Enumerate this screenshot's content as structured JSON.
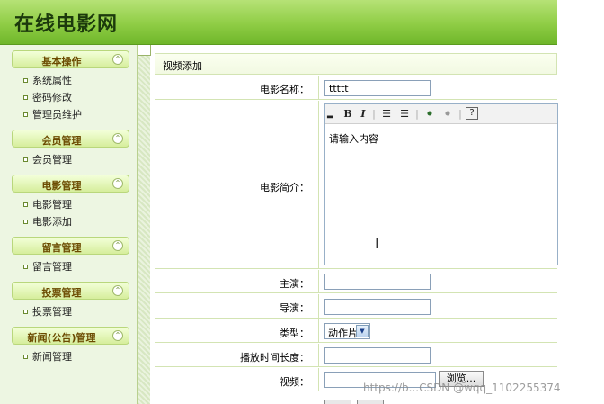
{
  "app": {
    "title": "在线电影网"
  },
  "sidebar": {
    "groups": [
      {
        "title": "基本操作",
        "items": [
          "系统属性",
          "密码修改",
          "管理员维护"
        ]
      },
      {
        "title": "会员管理",
        "items": [
          "会员管理"
        ]
      },
      {
        "title": "电影管理",
        "items": [
          "电影管理",
          "电影添加"
        ]
      },
      {
        "title": "留言管理",
        "items": [
          "留言管理"
        ]
      },
      {
        "title": "投票管理",
        "items": [
          "投票管理"
        ]
      },
      {
        "title": "新闻(公告)管理",
        "items": [
          "新闻管理"
        ]
      }
    ]
  },
  "form": {
    "title": "视频添加",
    "fields": {
      "name": {
        "label": "电影名称：",
        "value": "ttttt"
      },
      "intro": {
        "label": "电影简介：",
        "value": "请输入内容"
      },
      "actors": {
        "label": "主演：",
        "value": ""
      },
      "director": {
        "label": "导演：",
        "value": ""
      },
      "type": {
        "label": "类型：",
        "value": "动作片"
      },
      "duration": {
        "label": "播放时间长度：",
        "value": ""
      },
      "video": {
        "label": "视频：",
        "value": "",
        "browse": "浏览..."
      }
    }
  },
  "watermark": "https://b...CSDN @wqq_1102255374"
}
